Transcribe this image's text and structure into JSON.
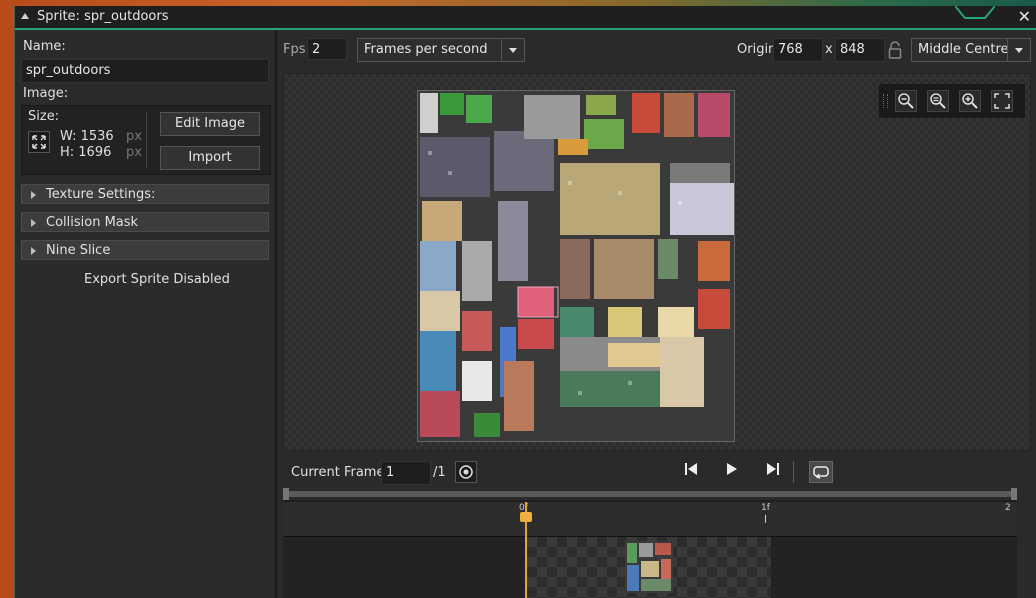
{
  "window": {
    "title": "Sprite: spr_outdoors"
  },
  "left": {
    "name_label": "Name:",
    "name_value": "spr_outdoors",
    "image_label": "Image:",
    "size_label": "Size:",
    "width": "W: 1536",
    "height": "H: 1696",
    "unit_w": "px",
    "unit_h": "px",
    "edit_image": "Edit Image",
    "import": "Import",
    "sections": [
      "Texture Settings:",
      "Collision Mask",
      "Nine Slice"
    ],
    "export_status": "Export Sprite Disabled"
  },
  "toolbar": {
    "fps_label": "Fps",
    "fps_value": "2",
    "fps_mode": "Frames per second",
    "origin_label": "Origin",
    "origin_x": "768",
    "origin_sep": "x",
    "origin_y": "848",
    "origin_mode": "Middle Centre"
  },
  "frame": {
    "current_label": "Current Frame:",
    "current_value": "1",
    "total": "/1"
  },
  "timeline": {
    "ticks": [
      "0f",
      "1f",
      "2"
    ]
  }
}
